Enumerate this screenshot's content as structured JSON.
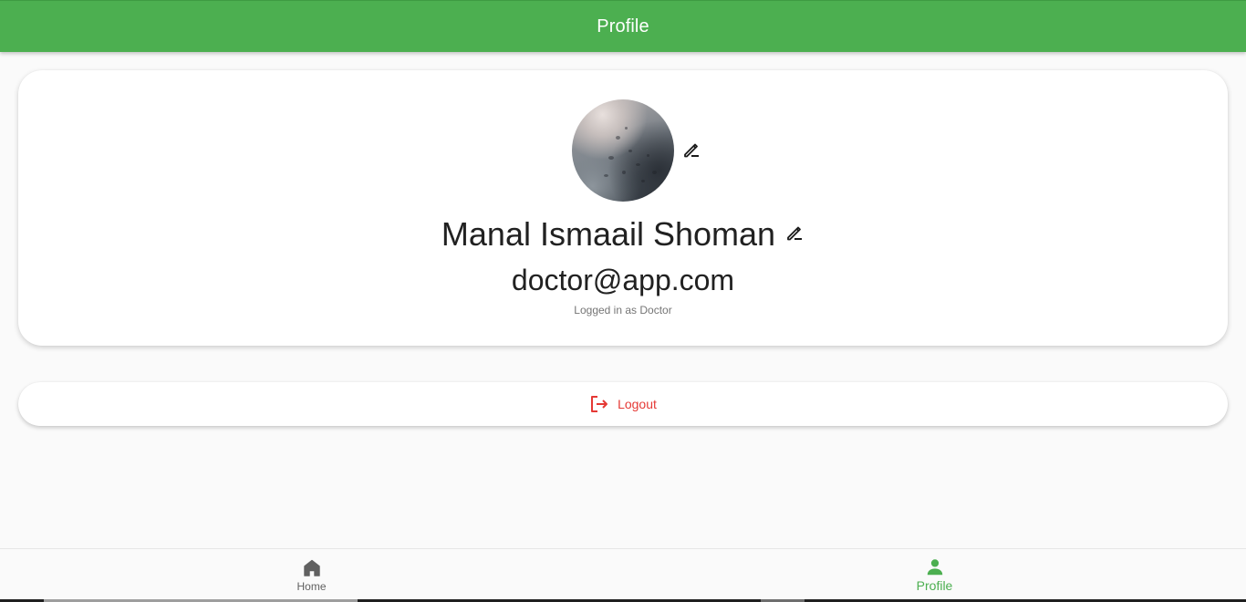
{
  "app_bar": {
    "title": "Profile",
    "color": "#4caf50"
  },
  "profile": {
    "avatar_alt": "profile-photo",
    "name": "Manal Ismaail Shoman",
    "email": "doctor@app.com",
    "role_text": "Logged in as Doctor",
    "edit_photo_icon": "edit-pencil-icon",
    "edit_name_icon": "edit-pencil-icon"
  },
  "logout": {
    "label": "Logout",
    "icon": "logout-icon",
    "color": "#e53935"
  },
  "bottom_nav": {
    "items": [
      {
        "label": "Home",
        "icon": "home-icon",
        "active": false
      },
      {
        "label": "Profile",
        "icon": "person-icon",
        "active": true
      }
    ],
    "active_color": "#4caf50",
    "inactive_color": "#616161"
  }
}
